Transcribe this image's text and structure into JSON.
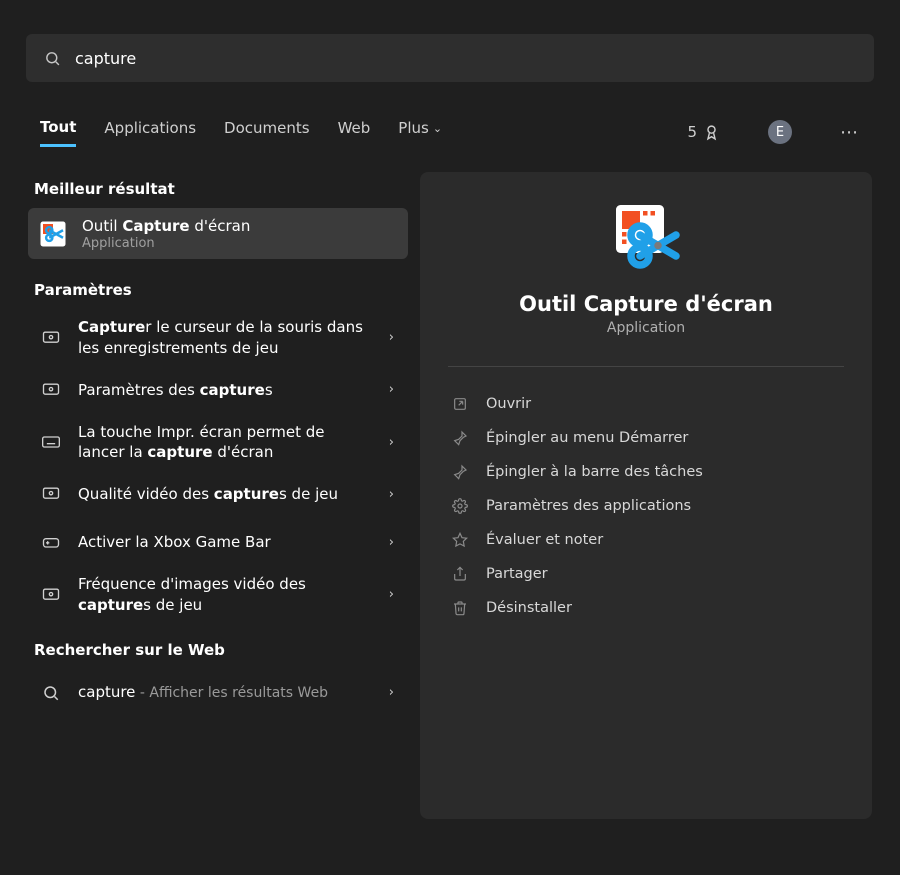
{
  "search": {
    "query": "capture"
  },
  "tabs": {
    "all": "Tout",
    "apps": "Applications",
    "docs": "Documents",
    "web": "Web",
    "more": "Plus"
  },
  "topright": {
    "points": "5",
    "avatar": "E"
  },
  "sections": {
    "best": "Meilleur résultat",
    "settings": "Paramètres",
    "searchweb": "Rechercher sur le Web"
  },
  "best_result": {
    "title_pre": "Outil ",
    "title_bold": "Capture",
    "title_post": " d'écran",
    "subtitle": "Application"
  },
  "settings_results": {
    "r1_pre": "Capture",
    "r1_post": "r le curseur de la souris dans les enregistrements de jeu",
    "r2_pre": "Paramètres des ",
    "r2_bold": "capture",
    "r2_post": "s",
    "r3_pre": "La touche Impr. écran permet de lancer la ",
    "r3_bold": "capture",
    "r3_post": " d'écran",
    "r4_pre": "Qualité vidéo des ",
    "r4_bold": "capture",
    "r4_post": "s de jeu",
    "r5": "Activer la Xbox Game Bar",
    "r6_pre": "Fréquence d'images vidéo des ",
    "r6_bold": "capture",
    "r6_post": "s de jeu"
  },
  "web_result": {
    "term": "capture",
    "suffix": " - Afficher les résultats Web"
  },
  "panel": {
    "title": "Outil Capture d'écran",
    "subtitle": "Application",
    "actions": {
      "open": "Ouvrir",
      "pin_start": "Épingler au menu Démarrer",
      "pin_taskbar": "Épingler à la barre des tâches",
      "app_settings": "Paramètres des applications",
      "rate": "Évaluer et noter",
      "share": "Partager",
      "uninstall": "Désinstaller"
    }
  }
}
